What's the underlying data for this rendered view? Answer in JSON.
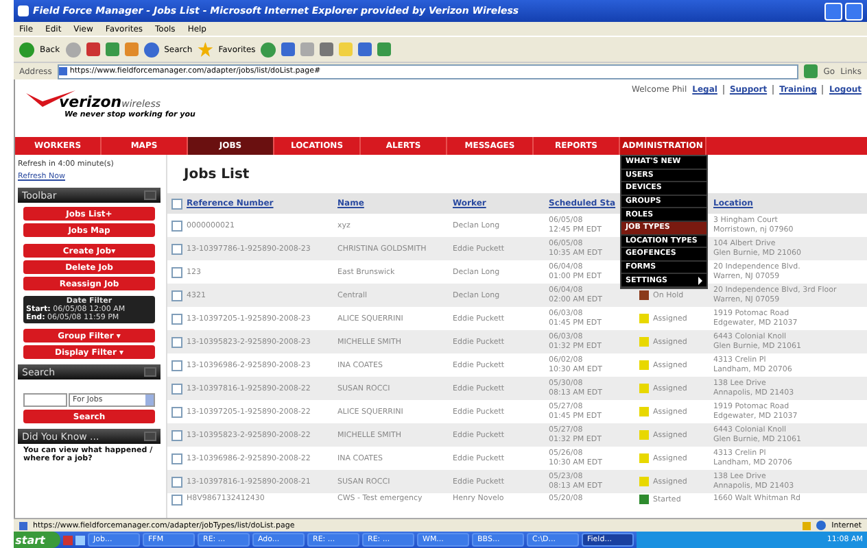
{
  "window": {
    "title": "Field Force Manager - Jobs List - Microsoft Internet Explorer provided by Verizon Wireless"
  },
  "menu": [
    "File",
    "Edit",
    "View",
    "Favorites",
    "Tools",
    "Help"
  ],
  "toolbar": {
    "back": "Back",
    "search": "Search",
    "favorites": "Favorites"
  },
  "address": {
    "label": "Address",
    "url": "https://www.fieldforcemanager.com/adapter/jobs/list/doList.page#",
    "go": "Go",
    "links": "Links"
  },
  "header": {
    "brand": "verizon",
    "brand_suffix": "wireless",
    "tagline": "We never stop working for you",
    "welcome": "Welcome Phil",
    "links": [
      "Legal",
      "Support",
      "Training",
      "Logout"
    ]
  },
  "nav": [
    {
      "label": "WORKERS",
      "selected": false,
      "open": false
    },
    {
      "label": "MAPS",
      "selected": false,
      "open": false
    },
    {
      "label": "JOBS",
      "selected": true,
      "open": false
    },
    {
      "label": "LOCATIONS",
      "selected": false,
      "open": false
    },
    {
      "label": "ALERTS",
      "selected": false,
      "open": false
    },
    {
      "label": "MESSAGES",
      "selected": false,
      "open": false
    },
    {
      "label": "REPORTS",
      "selected": false,
      "open": false
    },
    {
      "label": "ADMINISTRATION",
      "selected": false,
      "open": true
    }
  ],
  "admin_menu": [
    {
      "label": "WHAT'S NEW",
      "selected": false
    },
    {
      "label": "USERS",
      "selected": false
    },
    {
      "label": "DEVICES",
      "selected": false
    },
    {
      "label": "GROUPS",
      "selected": false
    },
    {
      "label": "ROLES",
      "selected": false
    },
    {
      "label": "JOB TYPES",
      "selected": true
    },
    {
      "label": "LOCATION TYPES",
      "selected": false
    },
    {
      "label": "GEOFENCES",
      "selected": false
    },
    {
      "label": "FORMS",
      "selected": false
    },
    {
      "label": "SETTINGS",
      "selected": false,
      "submenu": true
    }
  ],
  "sidebar": {
    "refresh": "Refresh in 4:00 minute(s)",
    "refresh_link": "Refresh Now",
    "toolbar": {
      "title": "Toolbar",
      "buttons": [
        {
          "label": "Jobs List",
          "suffix": "+"
        },
        {
          "label": "Jobs Map"
        },
        {
          "label": "Create Job",
          "suffix": "▾"
        },
        {
          "label": "Delete Job"
        },
        {
          "label": "Reassign Job"
        }
      ],
      "date_filter": {
        "title": "Date Filter",
        "start_label": "Start:",
        "start": "06/05/08 12:00 AM",
        "end_label": "End:",
        "end": "06/05/08 11:59 PM"
      },
      "filters": [
        {
          "label": "Group Filter",
          "suffix": "▾"
        },
        {
          "label": "Display Filter",
          "suffix": "▾"
        }
      ]
    },
    "search": {
      "title": "Search",
      "scope": "For Jobs",
      "button": "Search"
    },
    "tip": {
      "title": "Did You Know ...",
      "text": "You can view what happened / where for a job?"
    }
  },
  "page_title": "Jobs List",
  "table": {
    "select_all_checked": false,
    "columns": [
      "Reference Number",
      "Name",
      "Worker",
      "Scheduled Sta",
      "",
      "Location"
    ],
    "rows": [
      {
        "checked": false,
        "ref": "0000000021",
        "name": "xyz",
        "worker": "Declan Long",
        "date": "06/05/08",
        "time": "12:45 PM EDT",
        "loc1": "3 Hingham Court",
        "loc2": "Morristown, nj 07960"
      },
      {
        "checked": false,
        "ref": "13-10397786-1-925890-2008-23",
        "name": "CHRISTINA GOLDSMITH",
        "worker": "Eddie Puckett",
        "date": "06/05/08",
        "time": "10:35 AM EDT",
        "loc1": "104 Albert Drive",
        "loc2": "Glen Burnie, MD 21060"
      },
      {
        "checked": false,
        "ref": "123",
        "name": "East Brunswick",
        "worker": "Declan Long",
        "date": "06/04/08",
        "time": "01:00 PM EDT",
        "loc1": "20 Independence Blvd.",
        "loc2": "Warren, NJ 07059"
      },
      {
        "checked": false,
        "ref": "4321",
        "name": "Centrall",
        "worker": "Declan Long",
        "date": "06/04/08",
        "time": "02:00 AM EDT",
        "status": "On Hold",
        "color": "#8b3a1a",
        "loc1": "20 Independence Blvd, 3rd Floor",
        "loc2": "Warren, NJ 07059"
      },
      {
        "checked": false,
        "ref": "13-10397205-1-925890-2008-23",
        "name": "ALICE SQUERRINI",
        "worker": "Eddie Puckett",
        "date": "06/03/08",
        "time": "01:45 PM EDT",
        "status": "Assigned",
        "color": "#e8d800",
        "loc1": "1919 Potomac Road",
        "loc2": "Edgewater, MD 21037"
      },
      {
        "checked": false,
        "ref": "13-10395823-2-925890-2008-23",
        "name": "MICHELLE SMITH",
        "worker": "Eddie Puckett",
        "date": "06/03/08",
        "time": "01:32 PM EDT",
        "status": "Assigned",
        "color": "#e8d800",
        "loc1": "6443 Colonial Knoll",
        "loc2": "Glen Burnie, MD 21061"
      },
      {
        "checked": false,
        "ref": "13-10396986-2-925890-2008-23",
        "name": "INA COATES",
        "worker": "Eddie Puckett",
        "date": "06/02/08",
        "time": "10:30 AM EDT",
        "status": "Assigned",
        "color": "#e8d800",
        "loc1": "4313 Crelin Pl",
        "loc2": "Landham, MD 20706"
      },
      {
        "checked": false,
        "ref": "13-10397816-1-925890-2008-22",
        "name": "SUSAN ROCCI",
        "worker": "Eddie Puckett",
        "date": "05/30/08",
        "time": "08:13 AM EDT",
        "status": "Assigned",
        "color": "#e8d800",
        "loc1": "138 Lee Drive",
        "loc2": "Annapolis, MD 21403"
      },
      {
        "checked": false,
        "ref": "13-10397205-1-925890-2008-22",
        "name": "ALICE SQUERRINI",
        "worker": "Eddie Puckett",
        "date": "05/27/08",
        "time": "01:45 PM EDT",
        "status": "Assigned",
        "color": "#e8d800",
        "loc1": "1919 Potomac Road",
        "loc2": "Edgewater, MD 21037"
      },
      {
        "checked": false,
        "ref": "13-10395823-2-925890-2008-22",
        "name": "MICHELLE SMITH",
        "worker": "Eddie Puckett",
        "date": "05/27/08",
        "time": "01:32 PM EDT",
        "status": "Assigned",
        "color": "#e8d800",
        "loc1": "6443 Colonial Knoll",
        "loc2": "Glen Burnie, MD 21061"
      },
      {
        "checked": false,
        "ref": "13-10396986-2-925890-2008-22",
        "name": "INA COATES",
        "worker": "Eddie Puckett",
        "date": "05/26/08",
        "time": "10:30 AM EDT",
        "status": "Assigned",
        "color": "#e8d800",
        "loc1": "4313 Crelin Pl",
        "loc2": "Landham, MD 20706"
      },
      {
        "checked": false,
        "ref": "13-10397816-1-925890-2008-21",
        "name": "SUSAN ROCCI",
        "worker": "Eddie Puckett",
        "date": "05/23/08",
        "time": "08:13 AM EDT",
        "status": "Assigned",
        "color": "#e8d800",
        "loc1": "138 Lee Drive",
        "loc2": "Annapolis, MD 21403"
      },
      {
        "checked": false,
        "ref": "H8V9867132412430",
        "name": "CWS - Test emergency",
        "worker": "Henry Novelo",
        "date": "05/20/08",
        "status": "Started",
        "color": "#2e8b2e",
        "loc1": "1660 Walt Whitman Rd"
      }
    ]
  },
  "status_bar": {
    "url": "https://www.fieldforcemanager.com/adapter/jobTypes/list/doList.page",
    "zone": "Internet"
  },
  "taskbar": {
    "start": "start",
    "tasks": [
      "Job...",
      "FFM",
      "RE: ...",
      "Ado...",
      "RE: ...",
      "RE: ...",
      "WM...",
      "BBS...",
      "C:\\D...",
      "Field..."
    ],
    "clock": "11:08 AM"
  }
}
